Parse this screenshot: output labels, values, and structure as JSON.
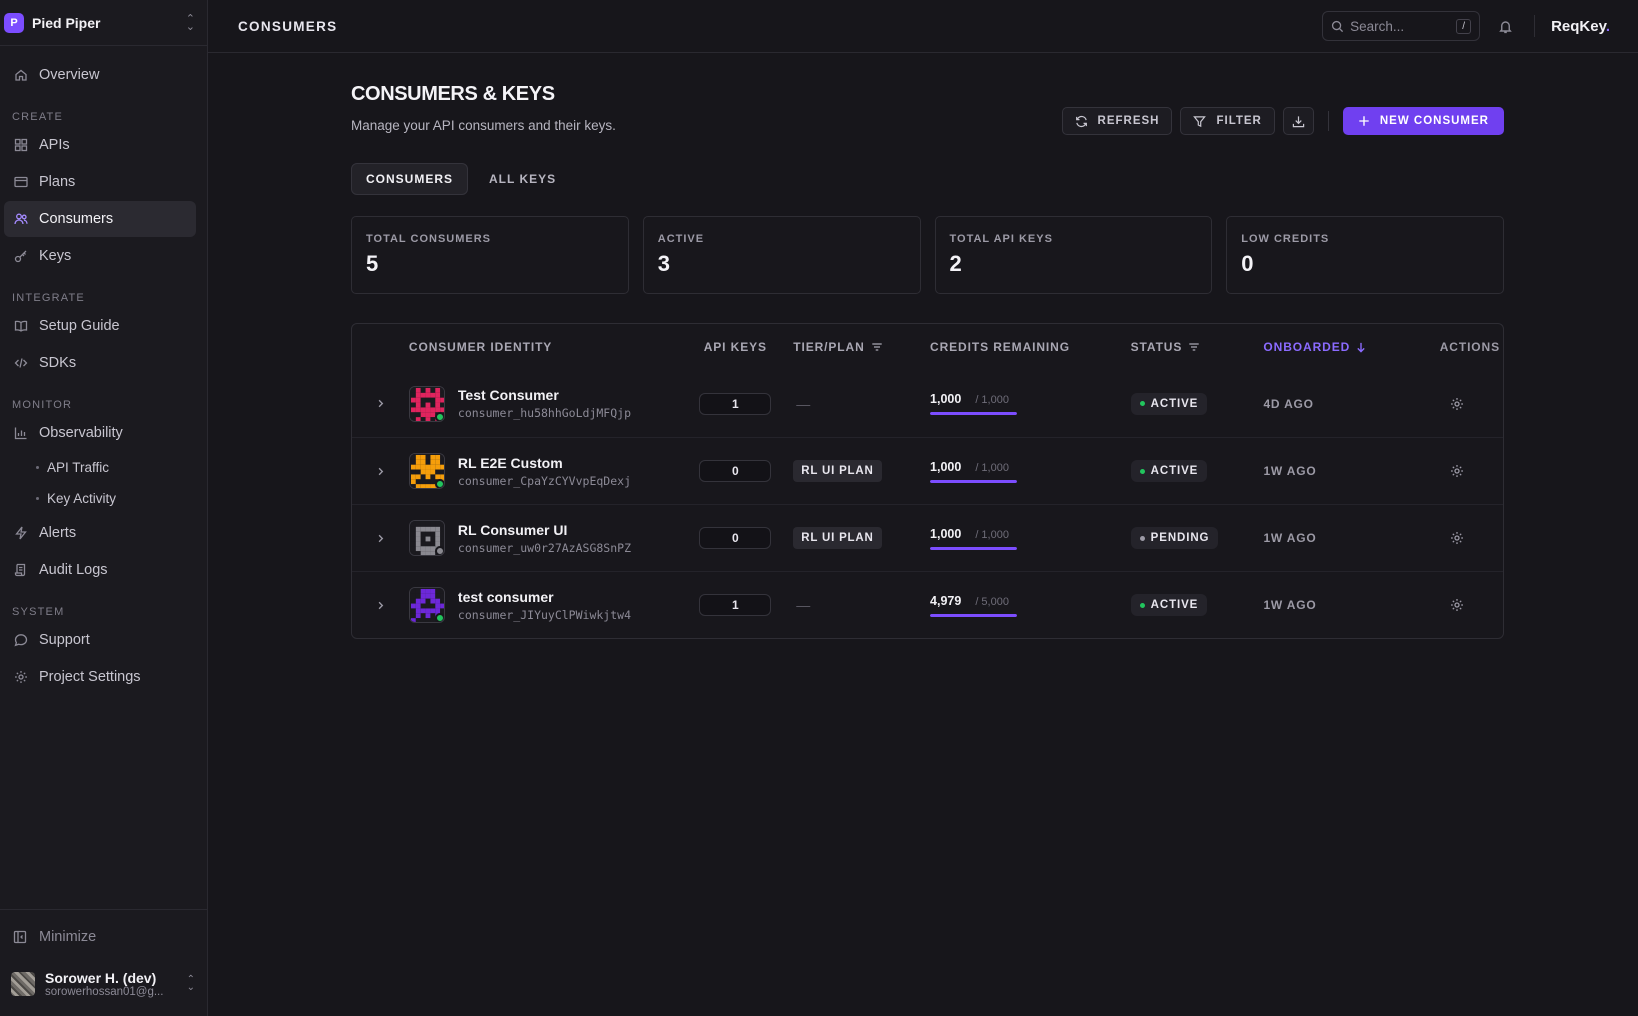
{
  "workspace": {
    "initial": "P",
    "name": "Pied Piper"
  },
  "nav": {
    "overview": "Overview",
    "create_label": "CREATE",
    "apis": "APIs",
    "plans": "Plans",
    "consumers": "Consumers",
    "keys": "Keys",
    "integrate_label": "INTEGRATE",
    "setup_guide": "Setup Guide",
    "sdks": "SDKs",
    "monitor_label": "MONITOR",
    "observability": "Observability",
    "api_traffic": "API Traffic",
    "key_activity": "Key Activity",
    "alerts": "Alerts",
    "audit_logs": "Audit Logs",
    "system_label": "SYSTEM",
    "support": "Support",
    "project_settings": "Project Settings",
    "minimize": "Minimize",
    "active_item": "Consumers"
  },
  "user": {
    "name": "Sorower H. (dev)",
    "email": "sorowerhossan01@g..."
  },
  "topbar": {
    "breadcrumb": "CONSUMERS",
    "search_placeholder": "Search...",
    "search_shortcut": "/",
    "brand": "ReqKey",
    "brand_dot": "."
  },
  "page": {
    "title": "CONSUMERS & KEYS",
    "subtitle": "Manage your API consumers and their keys.",
    "refresh_label": "REFRESH",
    "filter_label": "FILTER",
    "new_consumer_label": "NEW CONSUMER"
  },
  "tabs": [
    {
      "label": "CONSUMERS",
      "active": true
    },
    {
      "label": "ALL KEYS",
      "active": false
    }
  ],
  "stats": [
    {
      "label": "TOTAL CONSUMERS",
      "value": "5"
    },
    {
      "label": "ACTIVE",
      "value": "3"
    },
    {
      "label": "TOTAL API KEYS",
      "value": "2"
    },
    {
      "label": "LOW CREDITS",
      "value": "0"
    }
  ],
  "table": {
    "columns": {
      "identity": "CONSUMER IDENTITY",
      "api_keys": "API KEYS",
      "tier": "TIER/PLAN",
      "credits": "CREDITS REMAINING",
      "status": "STATUS",
      "onboarded": "ONBOARDED",
      "actions": "ACTIONS"
    },
    "sorted_column": "onboarded",
    "sort_direction": "descending",
    "rows": [
      {
        "name": "Test Consumer",
        "consumer_id": "consumer_hu58hhGoLdjMFQjp",
        "avatar_color": "#e0245e",
        "presence_color": "#22c55e",
        "api_keys": "1",
        "plan": "",
        "plan_empty": "—",
        "credits": "1,000",
        "credits_max": "/ 1,000",
        "credits_fraction": 1.0,
        "status": "ACTIVE",
        "status_color": "#22c55e",
        "onboarded": "4D AGO"
      },
      {
        "name": "RL E2E Custom",
        "consumer_id": "consumer_CpaYzCYVvpEqDexj",
        "avatar_color": "#f59e0b",
        "presence_color": "#22c55e",
        "api_keys": "0",
        "plan": "RL UI PLAN",
        "plan_empty": "",
        "credits": "1,000",
        "credits_max": "/ 1,000",
        "credits_fraction": 1.0,
        "status": "ACTIVE",
        "status_color": "#22c55e",
        "onboarded": "1W AGO"
      },
      {
        "name": "RL Consumer UI",
        "consumer_id": "consumer_uw0r27AzASG8SnPZ",
        "avatar_color": "#8a8990",
        "presence_color": "#8a8990",
        "api_keys": "0",
        "plan": "RL UI PLAN",
        "plan_empty": "",
        "credits": "1,000",
        "credits_max": "/ 1,000",
        "credits_fraction": 1.0,
        "status": "PENDING",
        "status_color": "#9c9aa6",
        "onboarded": "1W AGO"
      },
      {
        "name": "test consumer",
        "consumer_id": "consumer_JIYuyClPWiwkjtw4",
        "avatar_color": "#6d28d9",
        "presence_color": "#22c55e",
        "api_keys": "1",
        "plan": "",
        "plan_empty": "—",
        "credits": "4,979",
        "credits_max": "/ 5,000",
        "credits_fraction": 0.9958,
        "status": "ACTIVE",
        "status_color": "#22c55e",
        "onboarded": "1W AGO"
      }
    ]
  },
  "colors": {
    "accent": "#7c4dff",
    "primary_button": "#7040f0",
    "active_status": "#22c55e"
  },
  "icons": {
    "overview": "home-icon",
    "apis": "grid-icon",
    "plans": "card-icon",
    "consumers": "users-icon",
    "keys": "key-icon",
    "setup_guide": "book-icon",
    "sdks": "code-icon",
    "observability": "bar-chart-icon",
    "alerts": "bolt-icon",
    "audit_logs": "scroll-icon",
    "support": "chat-icon",
    "project_settings": "gear-icon"
  }
}
